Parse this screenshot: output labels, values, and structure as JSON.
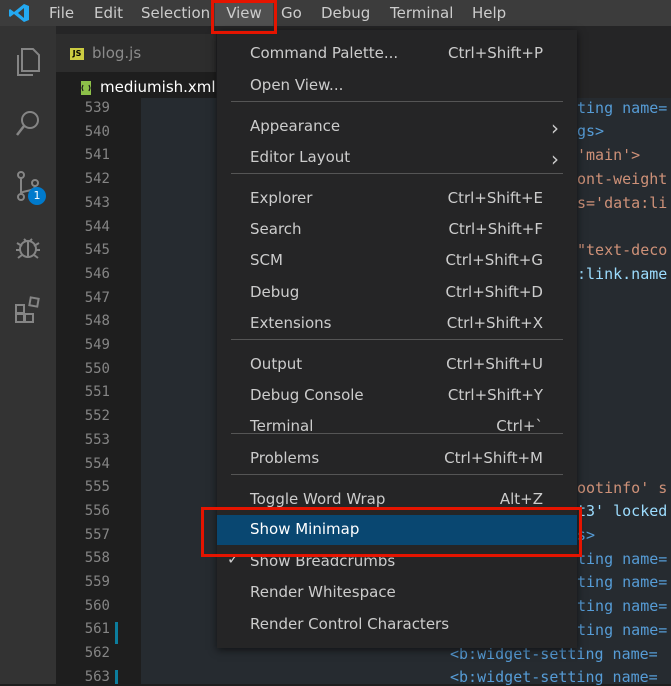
{
  "menubar": {
    "items": [
      {
        "label": "File"
      },
      {
        "label": "Edit"
      },
      {
        "label": "Selection"
      },
      {
        "label": "View"
      },
      {
        "label": "Go"
      },
      {
        "label": "Debug"
      },
      {
        "label": "Terminal"
      },
      {
        "label": "Help"
      }
    ]
  },
  "activity": {
    "scm_badge": "1"
  },
  "tabs": [
    {
      "label": "blog.js"
    },
    {
      "label": "mediumish.xml"
    }
  ],
  "gutter": {
    "lines": [
      "539",
      "540",
      "541",
      "542",
      "543",
      "544",
      "545",
      "546",
      "547",
      "548",
      "549",
      "550",
      "551",
      "552",
      "553",
      "554",
      "555",
      "556",
      "557",
      "558",
      "559",
      "560",
      "561",
      "562",
      "563"
    ]
  },
  "code": {
    "l539": "ting name=",
    "l540": "gs>",
    "l541": "'main'>",
    "l542": "ont-weight",
    "l543": "s='data:li",
    "l545": "\"text-deco",
    "l546": ":link.name",
    "l555": "ootinfo' s",
    "l556": "t3' locked",
    "l557": "s>",
    "l558": "ting name=",
    "l559": "ting name=",
    "l560": "ting name=",
    "l561": "ting name=",
    "l562": "<b:widget-setting name=",
    "l563": "<b:widget-setting name="
  },
  "view_menu": {
    "items": [
      {
        "label": "Command Palette...",
        "shortcut": "Ctrl+Shift+P"
      },
      {
        "label": "Open View...",
        "shortcut": ""
      },
      {
        "label": "Appearance",
        "shortcut": ""
      },
      {
        "label": "Editor Layout",
        "shortcut": ""
      },
      {
        "label": "Explorer",
        "shortcut": "Ctrl+Shift+E"
      },
      {
        "label": "Search",
        "shortcut": "Ctrl+Shift+F"
      },
      {
        "label": "SCM",
        "shortcut": "Ctrl+Shift+G"
      },
      {
        "label": "Debug",
        "shortcut": "Ctrl+Shift+D"
      },
      {
        "label": "Extensions",
        "shortcut": "Ctrl+Shift+X"
      },
      {
        "label": "Output",
        "shortcut": "Ctrl+Shift+U"
      },
      {
        "label": "Debug Console",
        "shortcut": "Ctrl+Shift+Y"
      },
      {
        "label": "Terminal",
        "shortcut": "Ctrl+`"
      },
      {
        "label": "Problems",
        "shortcut": "Ctrl+Shift+M"
      },
      {
        "label": "Toggle Word Wrap",
        "shortcut": "Alt+Z"
      },
      {
        "label": "Show Minimap",
        "shortcut": ""
      },
      {
        "label": "Show Breadcrumbs",
        "shortcut": ""
      },
      {
        "label": "Render Whitespace",
        "shortcut": ""
      },
      {
        "label": "Render Control Characters",
        "shortcut": ""
      }
    ]
  },
  "colors": {
    "accent": "#007acc",
    "highlight_box": "#e51400",
    "menu_selected": "#094771"
  }
}
